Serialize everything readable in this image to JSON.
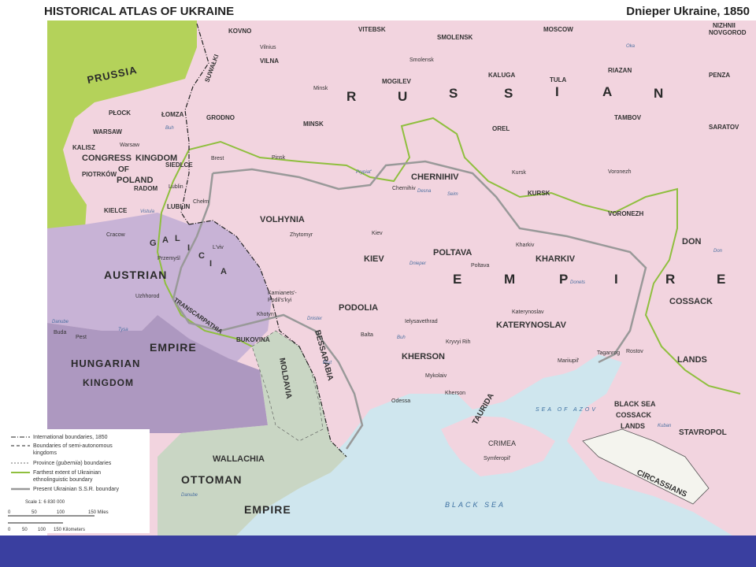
{
  "header": {
    "title": "HISTORICAL ATLAS OF UKRAINE",
    "subtitle": "Dnieper Ukraine, 1850"
  },
  "colors": {
    "russia": "#f2d4df",
    "prussia": "#b4d25a",
    "austria": "#c8b3d6",
    "hungary": "#ad98c0",
    "ottoman": "#c9d6c4",
    "circassians": "#f4f4ee",
    "sea": "#cfe6ee",
    "ukrainian_boundary": "#8fbf3e",
    "ssr_boundary": "#999999",
    "bottom_bar": "#3a3fa0"
  },
  "empires": {
    "prussia": "PRUSSIA",
    "russian": [
      "R",
      "U",
      "S",
      "S",
      "I",
      "A",
      "N"
    ],
    "empire": [
      "E",
      "M",
      "P",
      "I",
      "R",
      "E"
    ],
    "austrian": "AUSTRIAN",
    "austrian_empire": "EMPIRE",
    "hungarian": "HUNGARIAN",
    "kingdom": "KINGDOM",
    "ottoman": "OTTOMAN",
    "ottoman_empire": "EMPIRE",
    "congress": "CONGRESS",
    "kingdom_of": "KINGDOM",
    "of": "OF",
    "poland": "POLAND"
  },
  "regions": {
    "volhynia": "VOLHYNIA",
    "kiev": "KIEV",
    "podolia": "PODOLIA",
    "chernihiv": "CHERNIHIV",
    "poltava": "POLTAVA",
    "kharkiv": "KHARKIV",
    "kherson": "KHERSON",
    "katerynoslav": "KATERYNOSLAV",
    "bessarabia": "BESSARABIA",
    "moldavia": "MOLDAVIA",
    "wallachia": "WALLACHIA",
    "taurida": "TAURIDA",
    "crimea": "CRIMEA",
    "don": "DON",
    "cossack": "COSSACK",
    "lands": "LANDS",
    "black_sea_cossack": "BLACK SEA",
    "cossack2": "COSSACK",
    "lands2": "LANDS",
    "stavropol": "STAVROPOL",
    "circassians": "CIRCASSIANS",
    "galicia": [
      "G",
      "A",
      "L",
      "I",
      "C",
      "I",
      "A"
    ],
    "transcarpathia": "TRANSCARPATHIA",
    "bukovina": "BUKOVINA",
    "kovno": "KOVNO",
    "vilna": "VILNA",
    "vitebsk": "VITEBSK",
    "smolensk": "SMOLENSK",
    "moscow": "MOSCOW",
    "nizhnii": "NIZHNII",
    "novgorod": "NOVGOROD",
    "mogilev": "MOGILEV",
    "kaluga": "KALUGA",
    "tula": "TULA",
    "riazan": "RIAZAN",
    "penza": "PENZA",
    "minsk": "MINSK",
    "orel": "OREL",
    "tambov": "TAMBOV",
    "saratov": "SARATOV",
    "kursk": "KURSK",
    "voronezh": "VORONEZH",
    "grodno": "GRODNO",
    "plock": "PŁOCK",
    "lomza": "ŁOMZA",
    "warsaw": "WARSAW",
    "kalisz": "KALISZ",
    "siedlce": "SIEDLCE",
    "piotrkow": "PIOTRKÓW",
    "radom": "RADOM",
    "kielce": "KIELCE",
    "lublin": "LUBLIN",
    "suwalki": "SUWAŁKI"
  },
  "cities": {
    "vilnius": "Vilnius",
    "smolensk": "Smolensk",
    "minsk": "Minsk",
    "pinsk": "Pinsk",
    "brest": "Brest",
    "warsaw": "Warsaw",
    "lublin": "Lublin",
    "chelm": "Chełm",
    "cracow": "Cracow",
    "przemysl": "Przemyśl",
    "lviv": "L'viv",
    "uzhhorod": "Uzhhorod",
    "buda": "Buda",
    "pest": "Pest",
    "zhytomyr": "Zhytomyr",
    "kiev": "Kiev",
    "chernihiv": "Chernihiv",
    "kursk": "Kursk",
    "voronezh": "Voronezh",
    "kharkiv": "Kharkiv",
    "poltava": "Poltava",
    "kamianets": "Kamianets'-",
    "podilskyi": "Podil's'kyi",
    "khotyn": "Khotyn",
    "balta": "Balta",
    "ielysavethrad": "Ielysavethrad",
    "kryvyi_rih": "Kryvyi Rih",
    "katerynoslav": "Katerynoslav",
    "mykolaiv": "Mykolaiv",
    "kherson": "Kherson",
    "odessa": "Odessa",
    "simferopil": "Symferopil'",
    "mariiupil": "Mariiupil'",
    "taganrog": "Taganrog",
    "rostov": "Rostov"
  },
  "water": {
    "sea_of_azov": "SEA OF AZOV",
    "black_sea": "BLACK SEA",
    "rivers": {
      "oka": "Oka",
      "buh": "Buh",
      "vistula": "Vistula",
      "prypiat": "Prypiat'",
      "desna": "Desna",
      "seim": "Seim",
      "dnieper": "Dnieper",
      "donets": "Donets",
      "danube": "Danube",
      "danube2": "Danube",
      "tysa": "Tysa",
      "buh2": "Buh",
      "dnister": "Dnister",
      "prut": "Prut",
      "don": "Don",
      "kuban": "Kuban"
    }
  },
  "legend": {
    "items": [
      "International boundaries, 1850",
      "Boundaries of semi-autonomous",
      "kingdoms",
      "Province (",
      "guberniia",
      ") boundaries",
      "Farthest extent of Ukrainian",
      "ethnolinguistic boundary",
      "Present Ukrainian S.S.R. boundary"
    ],
    "scale": "Scale 1: 6 830 000",
    "miles_ticks": [
      "0",
      "50",
      "100",
      "150 Miles"
    ],
    "km_ticks": [
      "0",
      "50",
      "100",
      "150 Kilometers"
    ]
  }
}
